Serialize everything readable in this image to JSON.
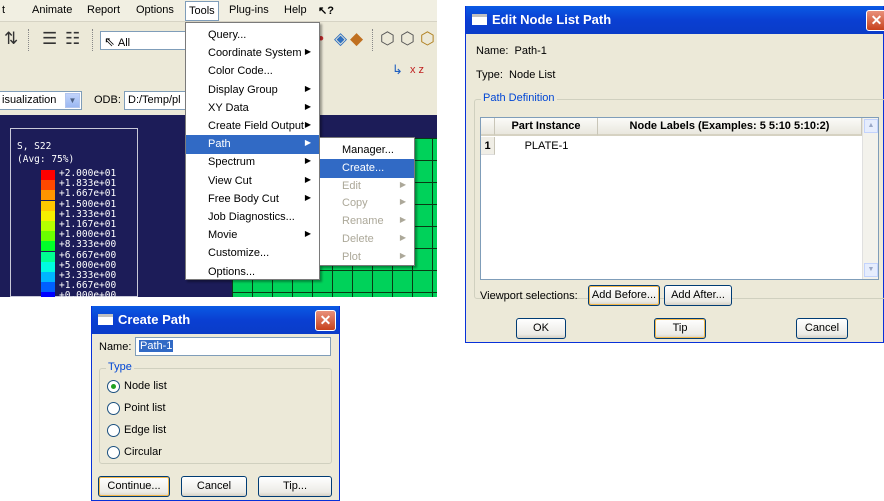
{
  "main": {
    "menubar": [
      "t",
      "Animate",
      "Report",
      "Options",
      "Tools",
      "Plug-ins",
      "Help",
      "↖?"
    ],
    "toolbar": {
      "filter_value": "All",
      "module_partial": "isualization",
      "odb_label": "ODB:",
      "odb_value": "D:/Temp/pl"
    },
    "legend": {
      "title": "S, S22",
      "subtitle": "(Avg: 75%)",
      "values": [
        "+2.000e+01",
        "+1.833e+01",
        "+1.667e+01",
        "+1.500e+01",
        "+1.333e+01",
        "+1.167e+01",
        "+1.000e+01",
        "+8.333e+00",
        "+6.667e+00",
        "+5.000e+00",
        "+3.333e+00",
        "+1.667e+00",
        "+0.000e+00"
      ],
      "colors": [
        "#ff0000",
        "#ff4800",
        "#ff9400",
        "#ffc800",
        "#f5f000",
        "#b4ff00",
        "#6aff00",
        "#00ff2a",
        "#00ff92",
        "#00fbe0",
        "#00b6ff",
        "#0060ff",
        "#0000ff"
      ]
    }
  },
  "tools_menu": {
    "items": [
      {
        "label": "Query...",
        "submenu": false
      },
      {
        "label": "Coordinate System",
        "submenu": true
      },
      {
        "label": "Color Code...",
        "submenu": false
      },
      {
        "label": "Display Group",
        "submenu": true
      },
      {
        "label": "XY Data",
        "submenu": true
      },
      {
        "label": "Create Field Output",
        "submenu": true
      },
      {
        "label": "Path",
        "submenu": true
      },
      {
        "label": "Spectrum",
        "submenu": true
      },
      {
        "label": "View Cut",
        "submenu": true
      },
      {
        "label": "Free Body Cut",
        "submenu": true
      },
      {
        "label": "Job Diagnostics...",
        "submenu": false
      },
      {
        "label": "Movie",
        "submenu": true
      },
      {
        "label": "Customize...",
        "submenu": false
      },
      {
        "label": "Options...",
        "submenu": false
      }
    ],
    "highlighted": "Path"
  },
  "path_menu": {
    "items": [
      "Manager...",
      "Create...",
      "Edit",
      "Copy",
      "Rename",
      "Delete",
      "Plot"
    ],
    "highlighted": "Create..."
  },
  "create_path": {
    "title": "Create Path",
    "name_label": "Name:",
    "name_value": "Path-1",
    "type_label": "Type",
    "types": [
      "Node list",
      "Point list",
      "Edge list",
      "Circular"
    ],
    "selected_type": "Node list",
    "buttons": [
      "Continue...",
      "Cancel",
      "Tip..."
    ]
  },
  "edit_path": {
    "title": "Edit Node List Path",
    "name_line": "Name:  Path-1",
    "type_line": "Type:  Node List",
    "group_label": "Path Definition",
    "columns": [
      "Part Instance",
      "Node Labels (Examples: 5 5:10 5:10:2)"
    ],
    "rows": [
      {
        "index": "1",
        "instance": "PLATE-1",
        "labels": ""
      }
    ],
    "viewport_label": "Viewport selections:",
    "add_before": "Add Before...",
    "add_after": "Add After...",
    "buttons": [
      "OK",
      "Tip",
      "Cancel"
    ]
  }
}
